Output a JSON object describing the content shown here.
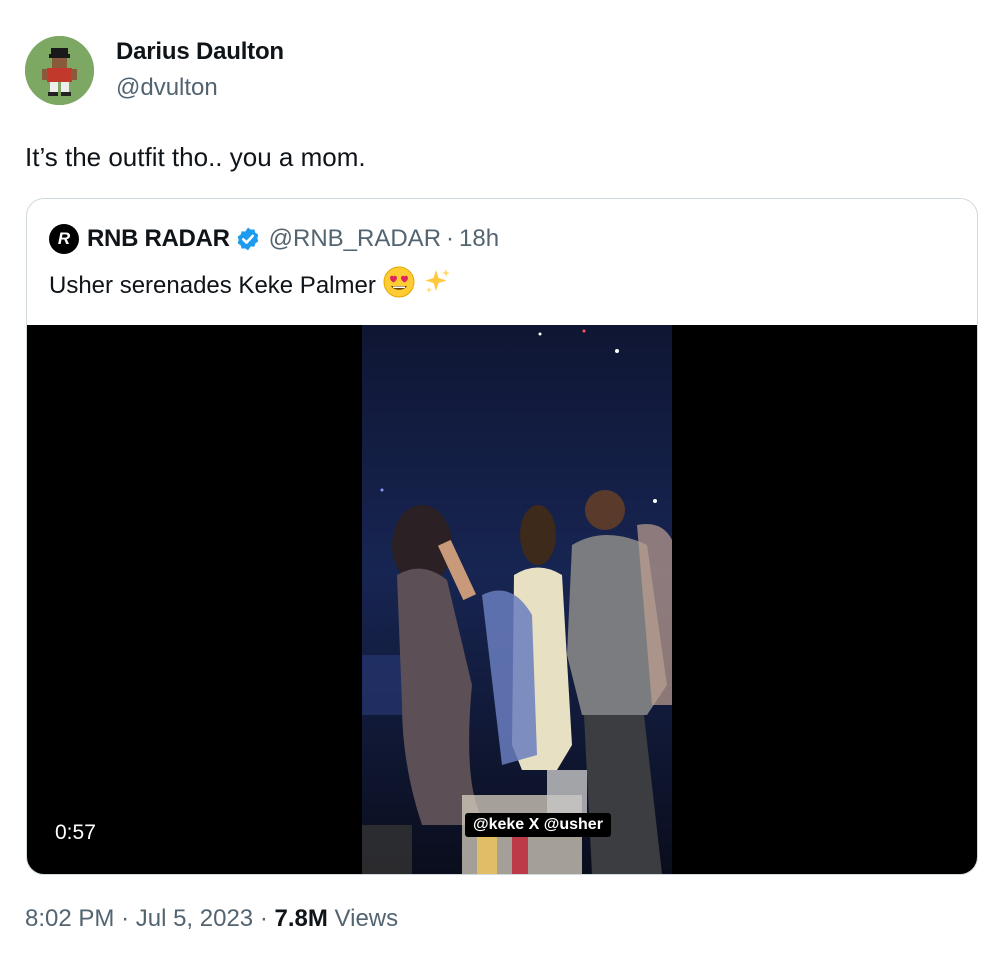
{
  "author": {
    "name": "Darius Daulton",
    "handle": "@dvulton"
  },
  "tweet": {
    "text": "It’s the outfit tho.. you a mom."
  },
  "quoted": {
    "name": "RNB RADAR",
    "avatar_letter": "R",
    "verified_icon": "verified-badge-icon",
    "handle": "@RNB_RADAR",
    "separator": "·",
    "time": "18h",
    "text": "Usher serenades Keke Palmer",
    "emojis": [
      "smiling-face-with-heart-eyes",
      "sparkles"
    ],
    "media": {
      "overlay_caption": "@keke X @usher",
      "duration": "0:57"
    }
  },
  "meta": {
    "time": "8:02 PM",
    "separator": "·",
    "date": "Jul 5, 2023",
    "views_count": "7.8M",
    "views_label": "Views"
  },
  "colors": {
    "text_primary": "#0f1419",
    "text_secondary": "#536471",
    "border": "#cfd9de",
    "verified_blue": "#1d9bf0"
  }
}
